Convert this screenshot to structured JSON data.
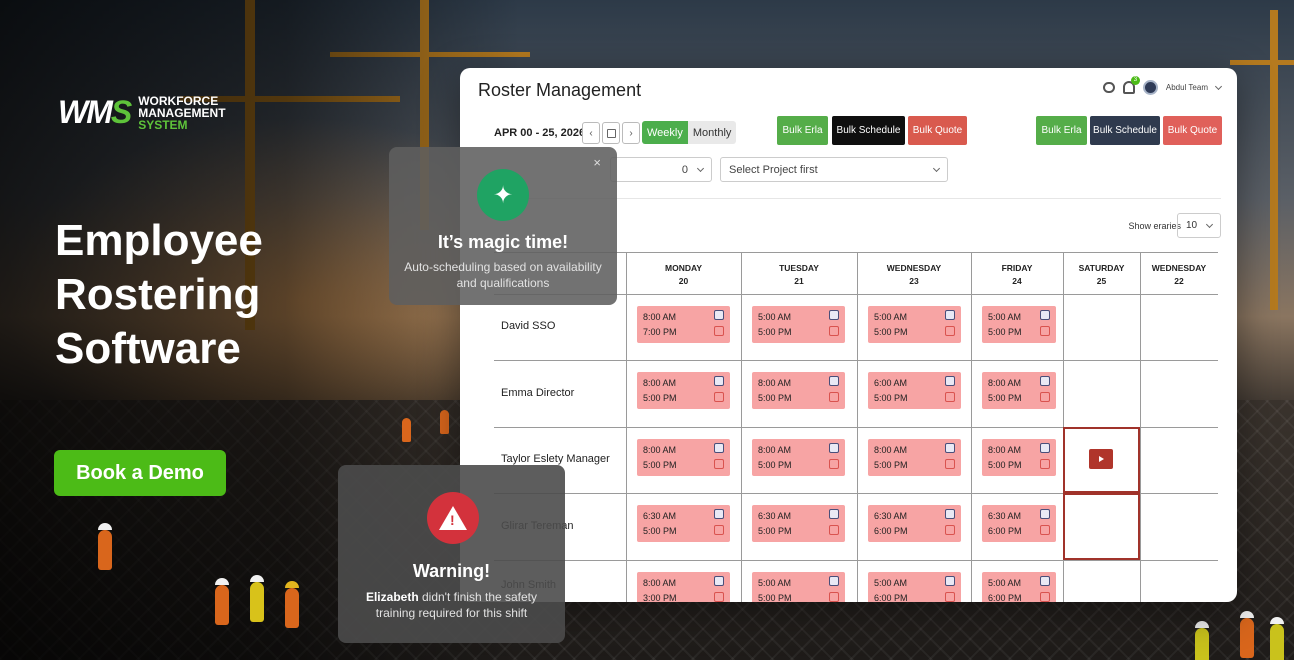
{
  "hero": {
    "logo_mark_a": "WM",
    "logo_mark_b": "S",
    "logo_line1": "WORKFORCE",
    "logo_line2": "MANAGEMENT",
    "logo_line3": "SYSTEM",
    "headline": "Employee Rostering Software",
    "cta": "Book a Demo"
  },
  "app": {
    "title": "Roster Management",
    "user": "Abdul Team",
    "bell_count": "3",
    "date_range": "APR 00 - 25, 2026",
    "prev": "‹",
    "next": "›",
    "views": [
      "Weekly",
      "Monthly"
    ],
    "buttons_left": [
      "Bulk Erla",
      "Bulk Schedule",
      "Bulk Quote"
    ],
    "buttons_right": [
      "Bulk Erla",
      "Bulk Schedule",
      "Bulk Quote"
    ],
    "filter_value": "0",
    "project_placeholder": "Select Project first",
    "show_entries_label": "Show eraries",
    "entries_value": "10",
    "days": [
      {
        "name": "MONDAY",
        "date": "20"
      },
      {
        "name": "TUESDAY",
        "date": "21"
      },
      {
        "name": "WEDNESDAY",
        "date": "23"
      },
      {
        "name": "FRIDAY",
        "date": "24"
      },
      {
        "name": "SATURDAY",
        "date": "25"
      },
      {
        "name": "WEDNESDAY",
        "date": "22"
      }
    ],
    "employees": [
      {
        "name": "David SSO",
        "shifts": [
          [
            "8:00 AM",
            "7:00 PM"
          ],
          [
            "5:00 AM",
            "5:00 PM"
          ],
          [
            "5:00 AM",
            "5:00 PM"
          ],
          [
            "5:00 AM",
            "5:00 PM"
          ]
        ]
      },
      {
        "name": "Emma Director",
        "shifts": [
          [
            "8:00 AM",
            "5:00 PM"
          ],
          [
            "8:00 AM",
            "5:00 PM"
          ],
          [
            "6:00 AM",
            "5:00 PM"
          ],
          [
            "8:00 AM",
            "5:00 PM"
          ]
        ]
      },
      {
        "name": "Taylor Eslety Manager",
        "shifts": [
          [
            "8:00 AM",
            "5:00 PM"
          ],
          [
            "8:00 AM",
            "5:00 PM"
          ],
          [
            "8:00 AM",
            "5:00 PM"
          ],
          [
            "8:00 AM",
            "5:00 PM"
          ]
        ]
      },
      {
        "name": "Glirar Tereman",
        "shifts": [
          [
            "6:30 AM",
            "5:00 PM"
          ],
          [
            "6:30 AM",
            "5:00 PM"
          ],
          [
            "6:30 AM",
            "6:00 PM"
          ],
          [
            "6:30 AM",
            "6:00 PM"
          ]
        ]
      },
      {
        "name": "John Smith",
        "shifts": [
          [
            "8:00 AM",
            "3:00 PM"
          ],
          [
            "5:00 AM",
            "5:00 PM"
          ],
          [
            "5:00 AM",
            "6:00 PM"
          ],
          [
            "5:00 AM",
            "6:00 PM"
          ]
        ]
      }
    ]
  },
  "magic": {
    "close": "×",
    "title": "It’s magic time!",
    "subtitle": "Auto-scheduling based on availability and qualifications"
  },
  "warning": {
    "title": "Warning!",
    "name": "Elizabeth",
    "message": " didn't finish the safety training required for this shift"
  }
}
